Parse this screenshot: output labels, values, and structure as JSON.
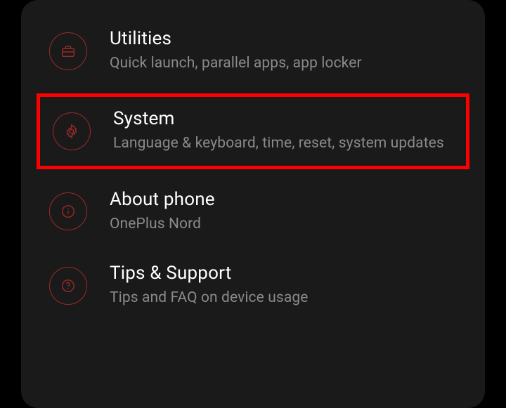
{
  "settings": {
    "items": [
      {
        "title": "Utilities",
        "subtitle": "Quick launch, parallel apps, app locker"
      },
      {
        "title": "System",
        "subtitle": "Language & keyboard, time, reset, system updates"
      },
      {
        "title": "About phone",
        "subtitle": "OnePlus Nord"
      },
      {
        "title": "Tips & Support",
        "subtitle": "Tips and FAQ on device usage"
      }
    ]
  },
  "colors": {
    "accent": "#9c2a2a",
    "highlight": "#ff0000",
    "background": "#1a1a1a"
  }
}
